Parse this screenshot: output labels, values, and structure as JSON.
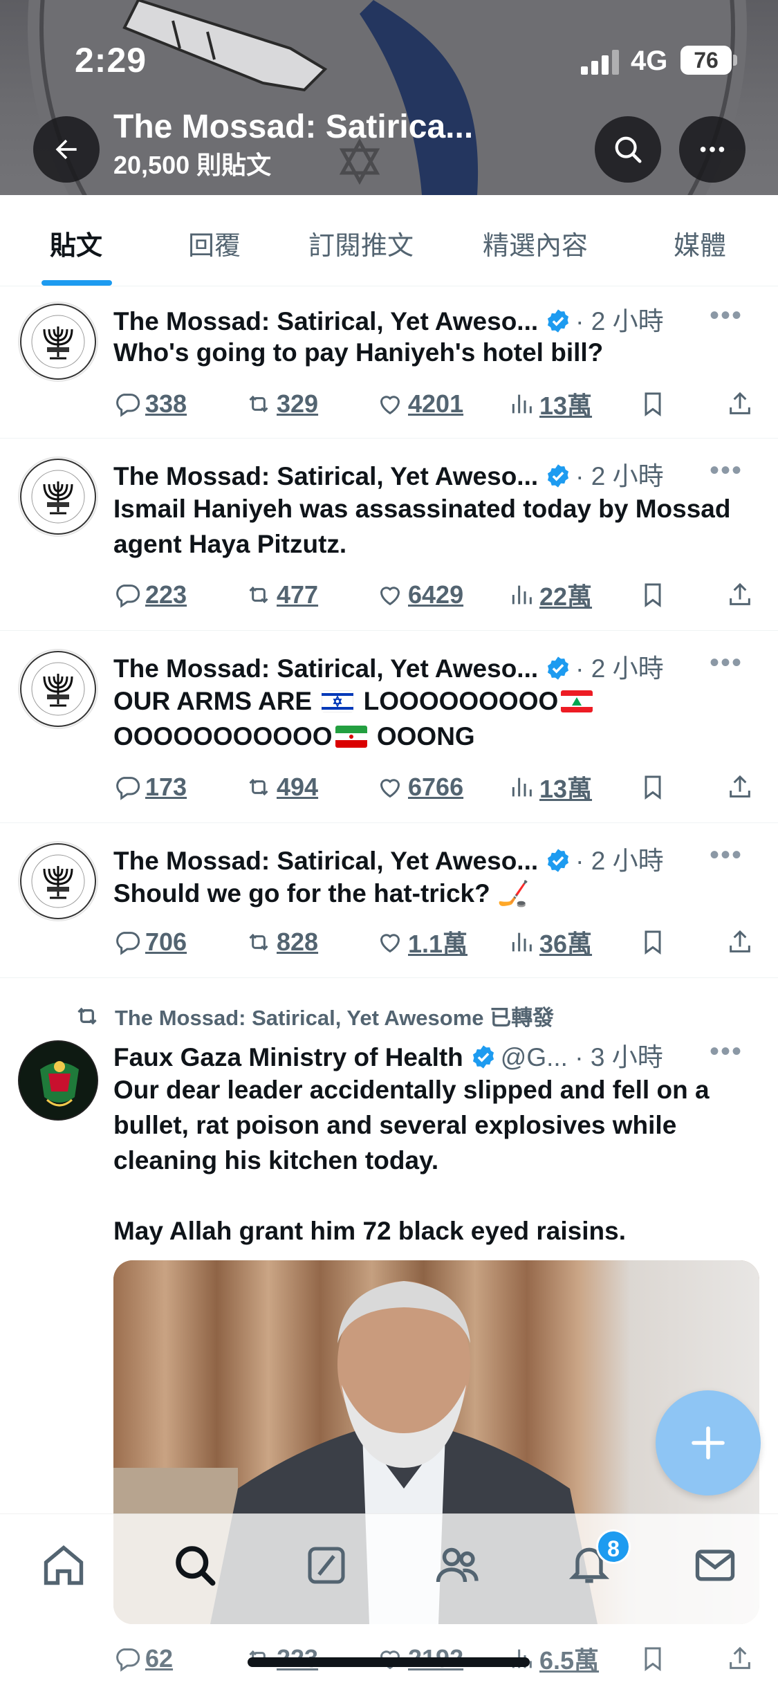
{
  "status_bar": {
    "time": "2:29",
    "network": "4G",
    "battery": "76"
  },
  "header": {
    "profile_name": "The Mossad: Satirica...",
    "post_count": "20,500 則貼文"
  },
  "tabs": [
    {
      "label": "貼文",
      "active": true
    },
    {
      "label": "回覆"
    },
    {
      "label": "訂閱推文"
    },
    {
      "label": "精選內容"
    },
    {
      "label": "媒體"
    }
  ],
  "tweets": [
    {
      "author": "The Mossad: Satirical, Yet Aweso...",
      "meta": "· 2 小時",
      "text": "Who's going to pay Haniyeh's hotel bill?",
      "replies": "338",
      "retweets": "329",
      "likes": "4201",
      "views": "13萬"
    },
    {
      "author": "The Mossad: Satirical, Yet Aweso...",
      "meta": "· 2 小時",
      "text": "Ismail Haniyeh was assassinated today by Mossad agent Haya Pitzutz.",
      "replies": "223",
      "retweets": "477",
      "likes": "6429",
      "views": "22萬"
    },
    {
      "author": "The Mossad: Satirical, Yet Aweso...",
      "meta": "· 2 小時",
      "text_part1": "OUR ARMS ARE ",
      "text_part2": " LOOOOOOOOO",
      "text_part3": "OOOOOOOOOOO",
      "text_part4": " OOONG",
      "replies": "173",
      "retweets": "494",
      "likes": "6766",
      "views": "13萬"
    },
    {
      "author": "The Mossad: Satirical, Yet Aweso...",
      "meta": "· 2 小時",
      "text": "Should we go for the hat-trick? 🏒",
      "replies": "706",
      "retweets": "828",
      "likes": "1.1萬",
      "views": "36萬"
    },
    {
      "retweeted_by": "The Mossad: Satirical, Yet Awesome 已轉發",
      "author": "Faux Gaza Ministry of Health",
      "meta": "@G... · 3 小時",
      "text": "Our dear leader accidentally slipped and fell on a bullet, rat poison and several explosives while cleaning his kitchen today.\n\nMay Allah grant him 72 black eyed raisins.",
      "replies": "62",
      "retweets": "223",
      "likes": "2192",
      "views": "6.5萬"
    }
  ],
  "bottom_nav": {
    "notification_count": "8"
  },
  "colors": {
    "accent": "#1d9bf0",
    "secondary_text": "#536471",
    "fab": "#8ec5f4"
  },
  "icons": [
    "back-arrow-icon",
    "search-icon",
    "more-icon",
    "verified-icon",
    "reply-icon",
    "retweet-icon",
    "like-icon",
    "views-icon",
    "bookmark-icon",
    "share-icon",
    "home-icon",
    "grok-icon",
    "people-icon",
    "bell-icon",
    "mail-icon",
    "plus-icon"
  ]
}
